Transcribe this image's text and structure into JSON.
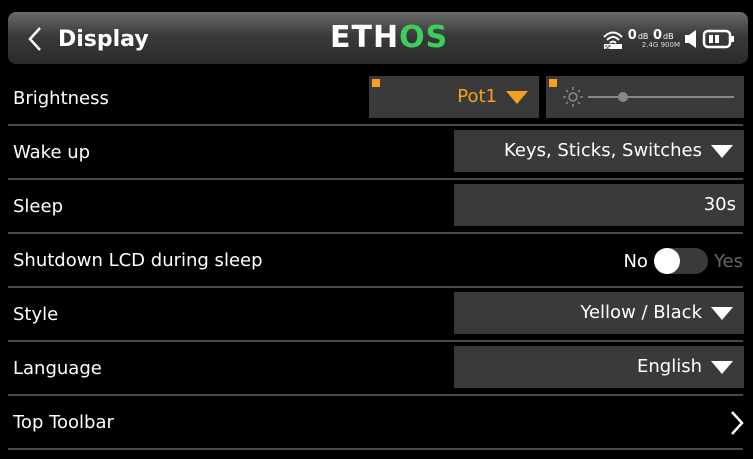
{
  "header": {
    "title": "Display",
    "logo_main": "ETH",
    "logo_accent": "OS",
    "status": {
      "rssi_1": "0",
      "rssi_1_unit": "dB",
      "rssi_2": "0",
      "rssi_2_unit": "dB",
      "band_1": "2.4G",
      "band_2": "900M"
    }
  },
  "rows": {
    "brightness": {
      "label": "Brightness",
      "source": "Pot1"
    },
    "wake_up": {
      "label": "Wake up",
      "value": "Keys, Sticks, Switches"
    },
    "sleep": {
      "label": "Sleep",
      "value": "30s"
    },
    "shutdown_lcd": {
      "label": "Shutdown LCD during sleep",
      "off_label": "No",
      "on_label": "Yes"
    },
    "style": {
      "label": "Style",
      "value": "Yellow / Black"
    },
    "language": {
      "label": "Language",
      "value": "English"
    },
    "top_toolbar": {
      "label": "Top Toolbar"
    }
  },
  "colors": {
    "accent": "#f4a21c",
    "logo_accent": "#3ccf5a",
    "field_bg": "#3a3a3a",
    "divider": "#4a4a4a"
  }
}
